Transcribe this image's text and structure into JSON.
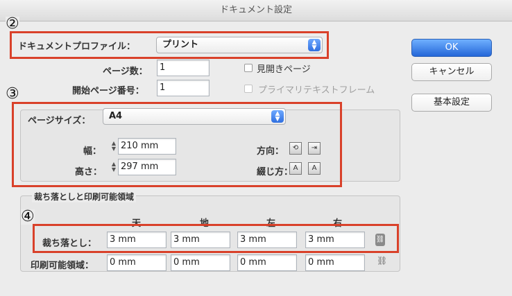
{
  "window": {
    "title": "ドキュメント設定"
  },
  "annotations": {
    "n2": "②",
    "n3": "③",
    "n4": "④"
  },
  "profile": {
    "label": "ドキュメントプロファイル：",
    "value": "プリント"
  },
  "pages": {
    "label": "ページ数：",
    "value": "1"
  },
  "start_page": {
    "label": "開始ページ番号：",
    "value": "1"
  },
  "facing_pages": {
    "label": "見開きページ",
    "checked": false
  },
  "primary_text_frame": {
    "label": "プライマリテキストフレーム",
    "checked": false,
    "enabled": false
  },
  "buttons": {
    "ok": "OK",
    "cancel": "キャンセル",
    "basic": "基本設定"
  },
  "page_size": {
    "label": "ページサイズ：",
    "value": "A4",
    "width_label": "幅：",
    "width_value": "210 mm",
    "height_label": "高さ：",
    "height_value": "297 mm",
    "orientation_label": "方向：",
    "binding_label": "綴じ方："
  },
  "bleed_section": {
    "title": "裁ち落としと印刷可能領域",
    "columns": [
      "天",
      "地",
      "左",
      "右"
    ],
    "bleed_label": "裁ち落とし：",
    "bleed_values": [
      "3 mm",
      "3 mm",
      "3 mm",
      "3 mm"
    ],
    "slug_label": "印刷可能領域：",
    "slug_values": [
      "0 mm",
      "0 mm",
      "0 mm",
      "0 mm"
    ]
  },
  "colors": {
    "accent": "#2f6fe0",
    "highlight": "#d9412a"
  },
  "icons": [
    "popup-arrow-icon",
    "stepper-icon",
    "portrait-icon",
    "landscape-icon",
    "binding-left-icon",
    "binding-right-icon",
    "link-icon"
  ]
}
